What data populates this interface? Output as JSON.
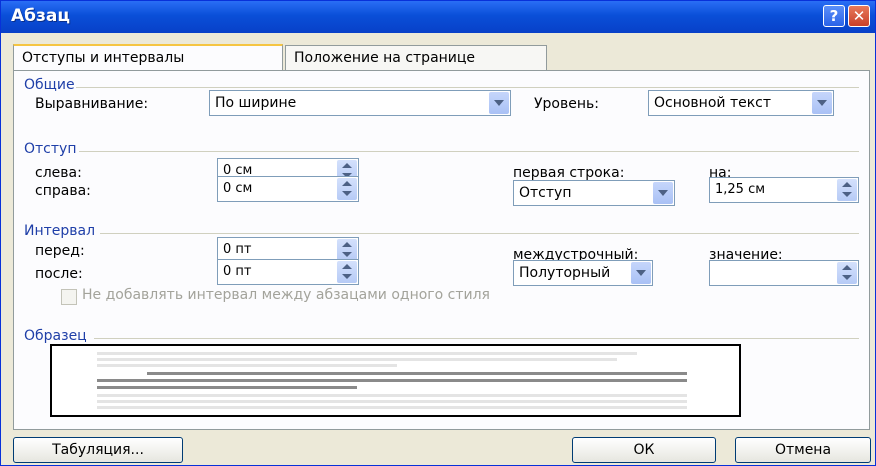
{
  "title": "Абзац",
  "title_buttons": {
    "help": "?",
    "close": "✕"
  },
  "tabs": [
    {
      "label": "Отступы и интервалы",
      "active": true
    },
    {
      "label": "Положение на странице",
      "active": false
    }
  ],
  "general": {
    "heading": "Общие",
    "alignment_label": "Выравнивание:",
    "alignment_value": "По ширине",
    "level_label": "Уровень:",
    "level_value": "Основной текст"
  },
  "indent": {
    "heading": "Отступ",
    "left_label": "слева:",
    "left_value": "0 см",
    "right_label": "справа:",
    "right_value": "0 см",
    "first_line_label": "первая строка:",
    "first_line_value": "Отступ",
    "by_label": "на:",
    "by_value": "1,25 см"
  },
  "spacing": {
    "heading": "Интервал",
    "before_label": "перед:",
    "before_value": "0 пт",
    "after_label": "после:",
    "after_value": "0 пт",
    "line_label": "междустрочный:",
    "line_value": "Полуторный",
    "value_label": "значение:",
    "value_value": "",
    "no_space_checkbox": "Не добавлять интервал между абзацами одного стиля",
    "no_space_checked": false
  },
  "sample": {
    "heading": "Образец"
  },
  "buttons": {
    "tabs": "Табуляция...",
    "ok": "ОК",
    "cancel": "Отмена"
  }
}
